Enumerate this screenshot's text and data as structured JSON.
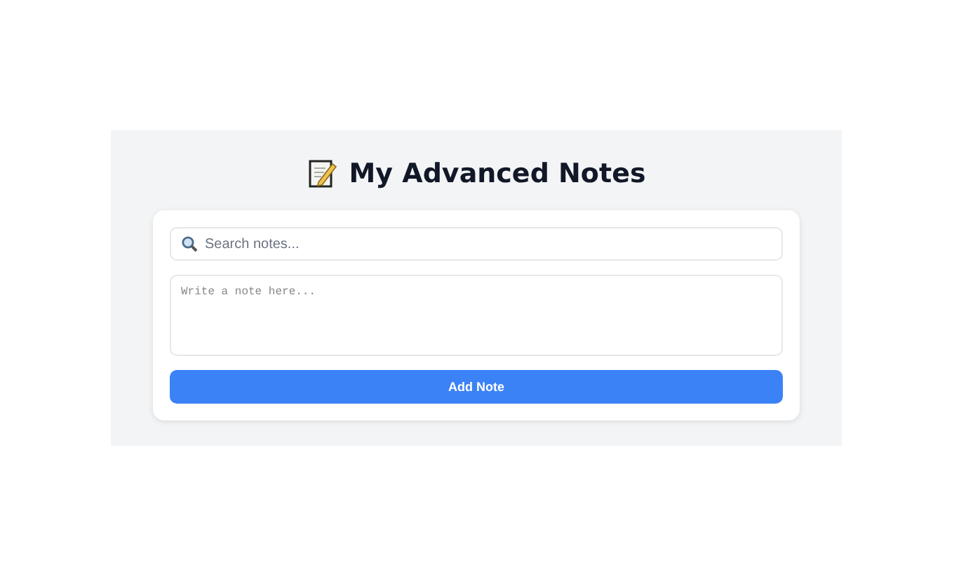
{
  "title": "My Advanced Notes",
  "search": {
    "placeholder": "Search notes..."
  },
  "note": {
    "placeholder": "Write a note here..."
  },
  "buttons": [
    "Add Note"
  ]
}
